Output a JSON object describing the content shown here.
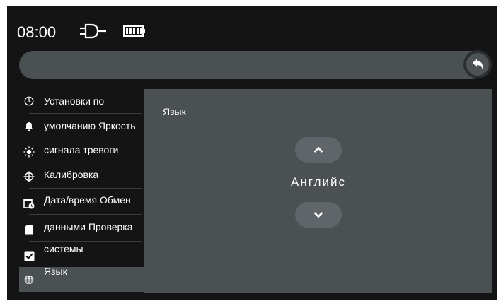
{
  "status_bar": {
    "time": "08:00",
    "icons": [
      "plug-icon",
      "battery-icon"
    ]
  },
  "sidebar": {
    "items": [
      {
        "label": "Установки по",
        "icon": "clock-icon"
      },
      {
        "label": "умолчанию Яркость",
        "icon": "bell-icon"
      },
      {
        "label": "сигнала тревоги",
        "icon": "sun-icon"
      },
      {
        "label": "Калибровка",
        "icon": "crosshair-icon"
      },
      {
        "label": "Дата/время Обмен",
        "icon": "calendar-clock-icon"
      },
      {
        "label": "данными Проверка",
        "icon": "sd-card-icon"
      },
      {
        "label": "системы",
        "icon": "checkbox-icon"
      },
      {
        "label": "Язык",
        "icon": "globe-icon"
      }
    ],
    "active_index": 7
  },
  "content": {
    "title": "Язык",
    "selected_value": "Английс"
  },
  "colors": {
    "screen_bg": "#141414",
    "panel_bg": "#4b5053",
    "pill_bg": "#5f6568",
    "text": "#ffffff"
  }
}
